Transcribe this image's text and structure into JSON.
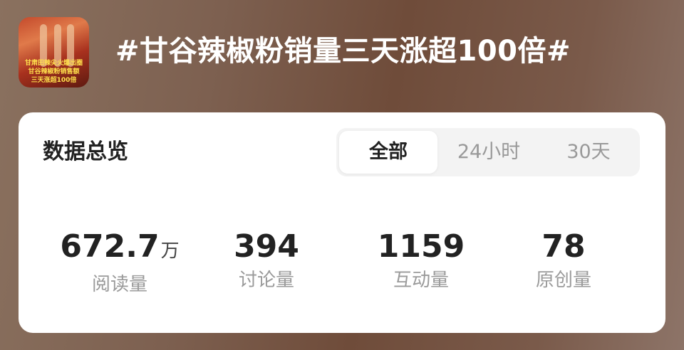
{
  "topic": {
    "title": "#甘谷辣椒粉销量三天涨超100倍#",
    "thumbnail_caption": [
      "甘肃田辣尖火爆出圈",
      "甘谷辣椒粉销售额",
      "三天涨超100倍"
    ]
  },
  "overview": {
    "title": "数据总览",
    "tabs": [
      {
        "label": "全部",
        "active": true
      },
      {
        "label": "24小时",
        "active": false
      },
      {
        "label": "30天",
        "active": false
      }
    ],
    "stats": [
      {
        "value": "672.7",
        "unit": "万",
        "label": "阅读量"
      },
      {
        "value": "394",
        "unit": "",
        "label": "讨论量"
      },
      {
        "value": "1159",
        "unit": "",
        "label": "互动量"
      },
      {
        "value": "78",
        "unit": "",
        "label": "原创量"
      }
    ]
  }
}
